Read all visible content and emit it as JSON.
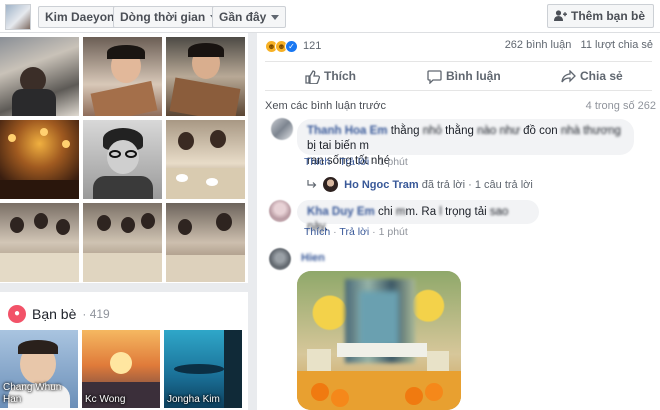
{
  "topbar": {
    "profile_name": "Kim Daeyong",
    "timeline_label": "Dòng thời gian",
    "recent_label": "Gần đây",
    "add_friend_label": "Thêm bạn bè"
  },
  "friends": {
    "title": "Bạn bè",
    "count": "· 419",
    "items": [
      {
        "name": "Chang Whun\nHan"
      },
      {
        "name": "Kc Wong"
      },
      {
        "name": "Jongha Kim"
      }
    ]
  },
  "post": {
    "reaction_count": "121",
    "comments_count": "262 bình luận",
    "shares_count": "11 lượt chia sẻ",
    "like_label": "Thích",
    "comment_label": "Bình luận",
    "share_label": "Chia sẻ",
    "view_previous": "Xem các bình luận trước",
    "pager": "4 trong số 262"
  },
  "comments": [
    {
      "author": "Thanh Hoa Em",
      "text_line1": "thằng ",
      "text_blur1": "nhỏ",
      "text_mid": " thằng ",
      "text_blur2": "nào như",
      "text_mid2": " đồ con ",
      "text_blur3": "nhà thương",
      "text_end": " bị tai biến m",
      "text_line2": "ran sống tốt nhé",
      "like": "Thích",
      "reply": "Trả lời",
      "time": "1 phút",
      "reply_author": "Ho Ngoc Tram",
      "reply_text": "đã trả lời",
      "reply_count": "1 câu trả lời"
    },
    {
      "author": "Kha Duy Em",
      "text_a": "chi ",
      "text_blur": "m",
      "text_b": "m. Ra ",
      "text_blur2": "l",
      "text_c": " trọng tải ",
      "text_blur3": "sao này",
      "text_d": ".",
      "like": "Thích",
      "reply": "Trả lời",
      "time": "1 phút"
    },
    {
      "author": "Hien"
    }
  ],
  "icons": [
    "like-reaction-icon",
    "haha-reaction-icon",
    "love-reaction-icon",
    "thumbs-up-icon",
    "comment-icon",
    "share-icon",
    "add-friend-icon",
    "friends-icon",
    "reply-arrow-icon"
  ]
}
